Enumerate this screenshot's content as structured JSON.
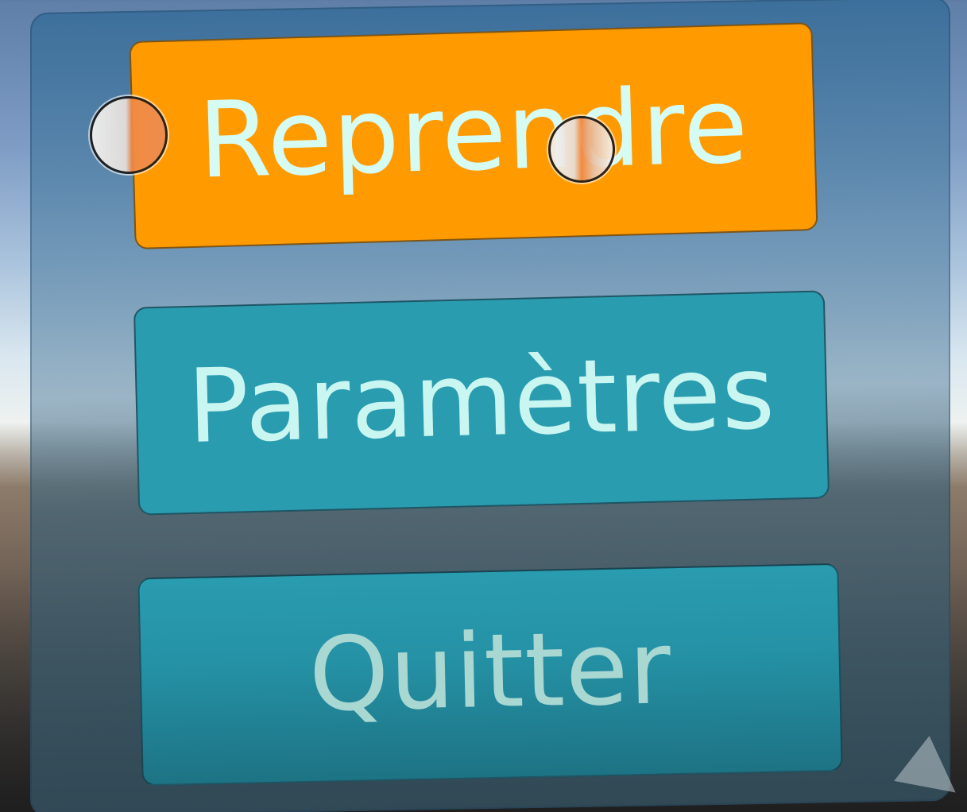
{
  "menu": {
    "buttons": [
      {
        "label": "Reprendre",
        "state": "hovered",
        "color": "#ff9a00"
      },
      {
        "label": "Paramètres",
        "state": "normal",
        "color": "#2a9cb0"
      },
      {
        "label": "Quitter",
        "state": "normal",
        "color": "#2a9cb0"
      }
    ]
  },
  "pointers": [
    {
      "icon": "controller-ray-pointer-icon"
    },
    {
      "icon": "controller-ray-pointer-icon"
    }
  ],
  "colors": {
    "panel": "#4f7ca0",
    "button_text": "#c9f6f1",
    "highlight": "#ff9a00",
    "button": "#2a9cb0"
  }
}
